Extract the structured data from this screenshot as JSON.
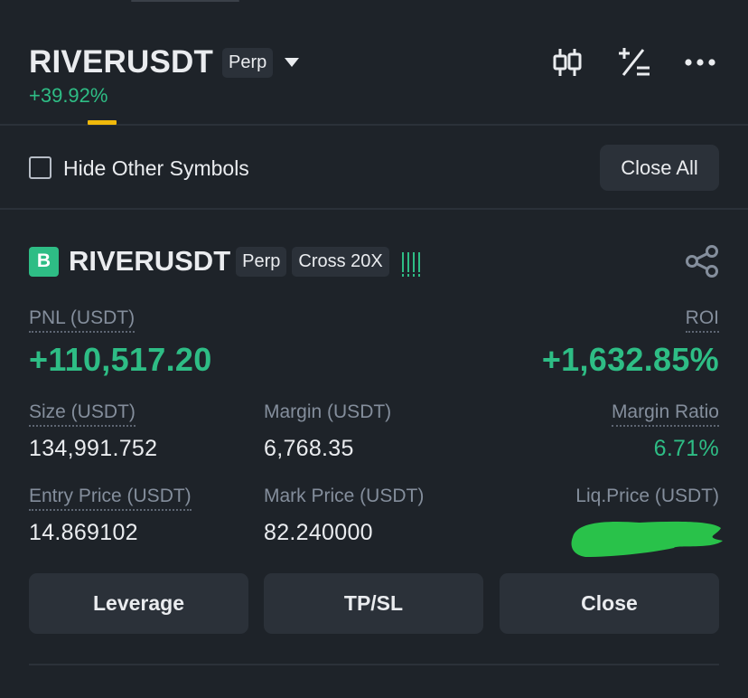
{
  "header": {
    "symbol": "RIVERUSDT",
    "contract_type": "Perp",
    "change": "+39.92%",
    "icons": [
      "candlestick-chart-icon",
      "plus-minus-calculator-icon",
      "more-dots-icon"
    ]
  },
  "filter": {
    "hide_other_symbols_label": "Hide Other Symbols",
    "hide_other_symbols_checked": false,
    "close_all_label": "Close All"
  },
  "position": {
    "side_badge": "B",
    "symbol": "RIVERUSDT",
    "contract_type": "Perp",
    "margin_mode": "Cross 20X",
    "pnl_label": "PNL (USDT)",
    "pnl_value": "+110,517.20",
    "roi_label": "ROI",
    "roi_value": "+1,632.85%",
    "size_label": "Size (USDT)",
    "size_value": "134,991.752",
    "margin_label": "Margin (USDT)",
    "margin_value": "6,768.35",
    "margin_ratio_label": "Margin Ratio",
    "margin_ratio_value": "6.71%",
    "entry_label": "Entry Price (USDT)",
    "entry_value": "14.869102",
    "mark_label": "Mark Price (USDT)",
    "mark_value": "82.240000",
    "liq_label": "Liq.Price (USDT)"
  },
  "actions": {
    "leverage": "Leverage",
    "tpsl": "TP/SL",
    "close": "Close"
  },
  "colors": {
    "background": "#1e2329",
    "surface": "#2b3139",
    "text": "#eaecef",
    "muted": "#848e9c",
    "profit": "#2ebd85",
    "accent": "#f0b90b",
    "redaction": "#29c24a"
  }
}
